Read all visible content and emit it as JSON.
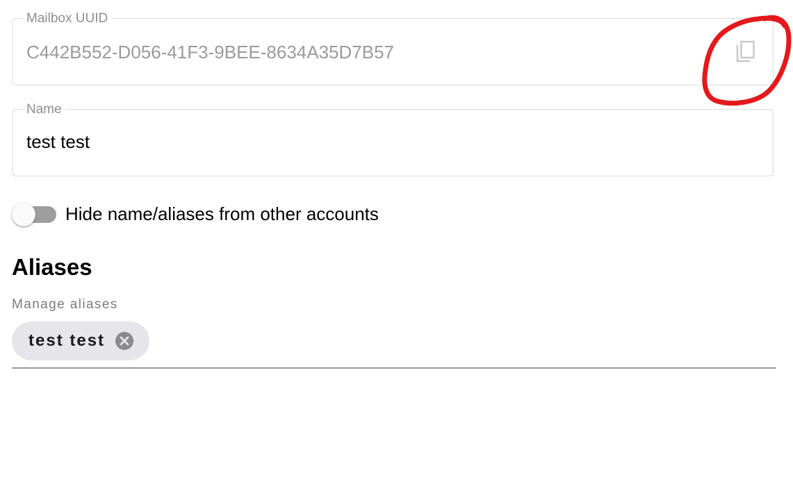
{
  "uuid_field": {
    "label": "Mailbox UUID",
    "value": "C442B552-D056-41F3-9BEE-8634A35D7B57",
    "copy_icon": "copy-icon"
  },
  "name_field": {
    "label": "Name",
    "value": "test test"
  },
  "hide_toggle": {
    "label": "Hide name/aliases from other accounts",
    "checked": false
  },
  "aliases": {
    "title": "Aliases",
    "manage_label": "Manage aliases",
    "chips": [
      {
        "label": "test test",
        "remove_icon": "close-circle-icon"
      }
    ]
  },
  "colors": {
    "annotation": "#e3191b",
    "toggle_track": "#9e9e9e",
    "chip_background": "#e6e6ea"
  }
}
